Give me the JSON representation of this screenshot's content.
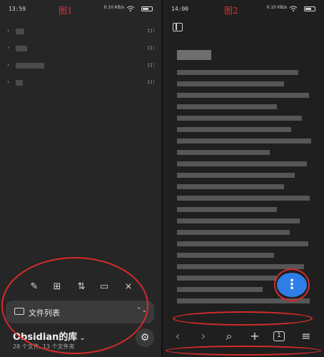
{
  "left": {
    "status_time": "13:59",
    "network": "0.10\nKB/s",
    "annotation": "图1",
    "toolbar": {
      "new_note_icon": "edit-icon",
      "new_folder_icon": "folder-plus-icon",
      "sort_icon": "sort-icon",
      "layout_icon": "layout-icon",
      "collapse_icon": "collapse-icon"
    },
    "file_list_label": "文件列表",
    "vault_name": "Obsidian的库",
    "vault_counts": "28 个文件, 13 个文件夹"
  },
  "right": {
    "status_time": "14:00",
    "network": "0.10\nKB/s",
    "annotation": "图2",
    "fab_label": "⋮",
    "tab_count": "1"
  },
  "colors": {
    "accent_blue": "#2f7ee8",
    "annotation_red": "#d62b2b"
  }
}
